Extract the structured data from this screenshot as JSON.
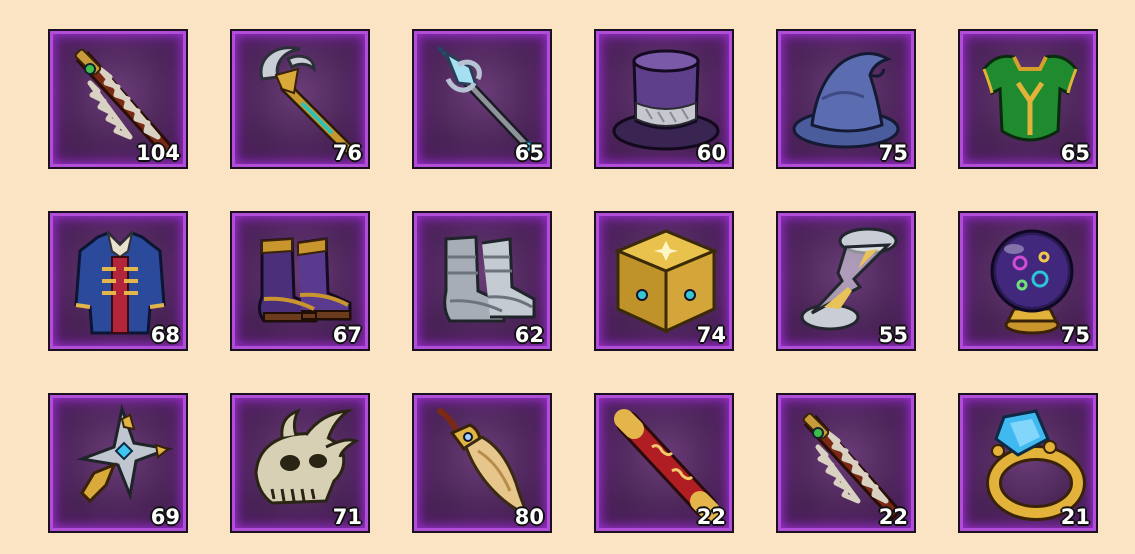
{
  "inventory": {
    "items": [
      {
        "icon": "serrated-sword-icon",
        "count": "104"
      },
      {
        "icon": "crescent-staff-icon",
        "count": "76"
      },
      {
        "icon": "crystal-staff-icon",
        "count": "65"
      },
      {
        "icon": "top-hat-icon",
        "count": "60"
      },
      {
        "icon": "wizard-hat-icon",
        "count": "75"
      },
      {
        "icon": "green-armor-icon",
        "count": "65"
      },
      {
        "icon": "blue-coat-icon",
        "count": "68"
      },
      {
        "icon": "purple-boots-icon",
        "count": "67"
      },
      {
        "icon": "steel-boots-icon",
        "count": "62"
      },
      {
        "icon": "golden-cube-icon",
        "count": "74"
      },
      {
        "icon": "hourglass-icon",
        "count": "55"
      },
      {
        "icon": "crystal-ball-icon",
        "count": "75"
      },
      {
        "icon": "cross-amulet-icon",
        "count": "69"
      },
      {
        "icon": "dragon-skull-icon",
        "count": "71"
      },
      {
        "icon": "claw-fang-icon",
        "count": "80"
      },
      {
        "icon": "red-scroll-icon",
        "count": "22"
      },
      {
        "icon": "serrated-sword-icon",
        "count": "22"
      },
      {
        "icon": "sapphire-ring-icon",
        "count": "21"
      }
    ]
  }
}
